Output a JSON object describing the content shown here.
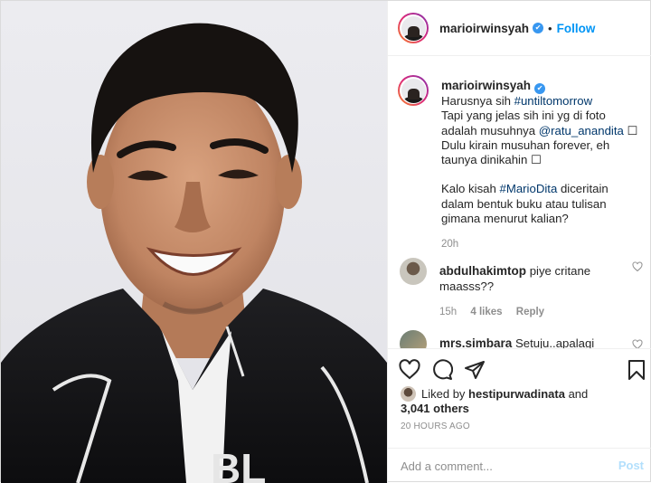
{
  "post": {
    "username": "marioirwinsyah",
    "follow_label": "Follow",
    "separator": "•",
    "verified_mark": "✔"
  },
  "caption": {
    "username": "marioirwinsyah",
    "line1_text": "Harusnya sih ",
    "line1_hashtag": "#untiltomorrow",
    "line2": "Tapi yang jelas sih ini yg di foto",
    "line3_text": "adalah musuhnya ",
    "line3_mention": "@ratu_anandita",
    "line3_emoji": " ☐",
    "line4": "Dulu kirain musuhan forever, eh",
    "line5": "taunya dinikahin ☐",
    "line6_text": "Kalo kisah ",
    "line6_hashtag": "#MarioDita",
    "line6_after": " diceritain",
    "line7": "dalam bentuk buku atau tulisan",
    "line8": "gimana menurut kalian?",
    "time": "20h"
  },
  "comments": [
    {
      "username": "abdulhakimtop",
      "text_line1": "piye critane",
      "text_line2": "maasss??",
      "time": "15h",
      "likes": "4 likes",
      "reply": "Reply"
    },
    {
      "username": "mrs.simbara",
      "text_line1": "Setuju..apalagi"
    }
  ],
  "actions": {
    "icons": [
      "heart-icon",
      "comment-icon",
      "share-icon",
      "bookmark-icon"
    ],
    "liked_by_prefix": "Liked by ",
    "liked_by_user": "hestipurwadinata",
    "liked_by_and": " and",
    "liked_by_count": "3,041 others",
    "time_ago": "20 HOURS AGO"
  },
  "add_comment": {
    "placeholder": "Add a comment...",
    "post_label": "Post"
  },
  "colors": {
    "link": "#00376b",
    "accent": "#0095f6",
    "verified": "#3897f0",
    "muted": "#8e8e8e",
    "post_disabled": "#b2dffc"
  }
}
